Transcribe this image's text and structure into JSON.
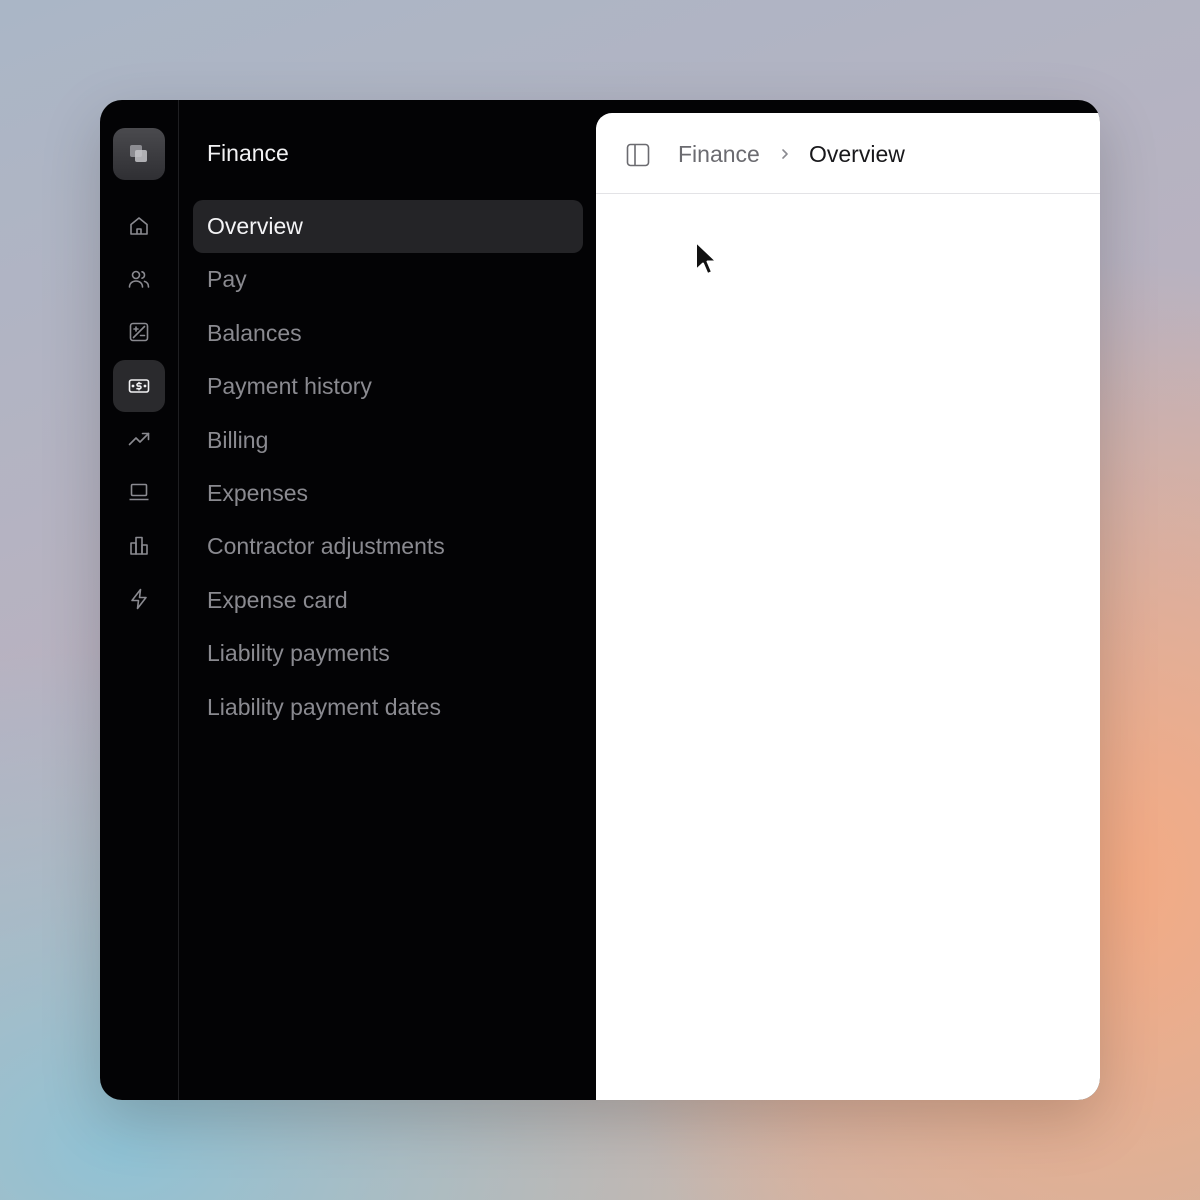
{
  "sidebar": {
    "title": "Finance",
    "icons": [
      {
        "name": "home-icon",
        "active": false
      },
      {
        "name": "people-icon",
        "active": false
      },
      {
        "name": "plus-minus-icon",
        "active": false
      },
      {
        "name": "dollar-bill-icon",
        "active": true
      },
      {
        "name": "trending-up-icon",
        "active": false
      },
      {
        "name": "laptop-icon",
        "active": false
      },
      {
        "name": "building-icon",
        "active": false
      },
      {
        "name": "lightning-icon",
        "active": false
      }
    ],
    "items": [
      {
        "label": "Overview",
        "active": true
      },
      {
        "label": "Pay",
        "active": false
      },
      {
        "label": "Balances",
        "active": false
      },
      {
        "label": "Payment history",
        "active": false
      },
      {
        "label": "Billing",
        "active": false
      },
      {
        "label": "Expenses",
        "active": false
      },
      {
        "label": "Contractor adjustments",
        "active": false
      },
      {
        "label": "Expense card",
        "active": false
      },
      {
        "label": "Liability payments",
        "active": false
      },
      {
        "label": "Liability payment dates",
        "active": false
      }
    ]
  },
  "breadcrumb": {
    "parent": "Finance",
    "current": "Overview"
  },
  "colors": {
    "window_bg": "#030305",
    "active_item_bg": "#242427",
    "inactive_text": "#8a8a90",
    "content_bg": "#ffffff"
  }
}
